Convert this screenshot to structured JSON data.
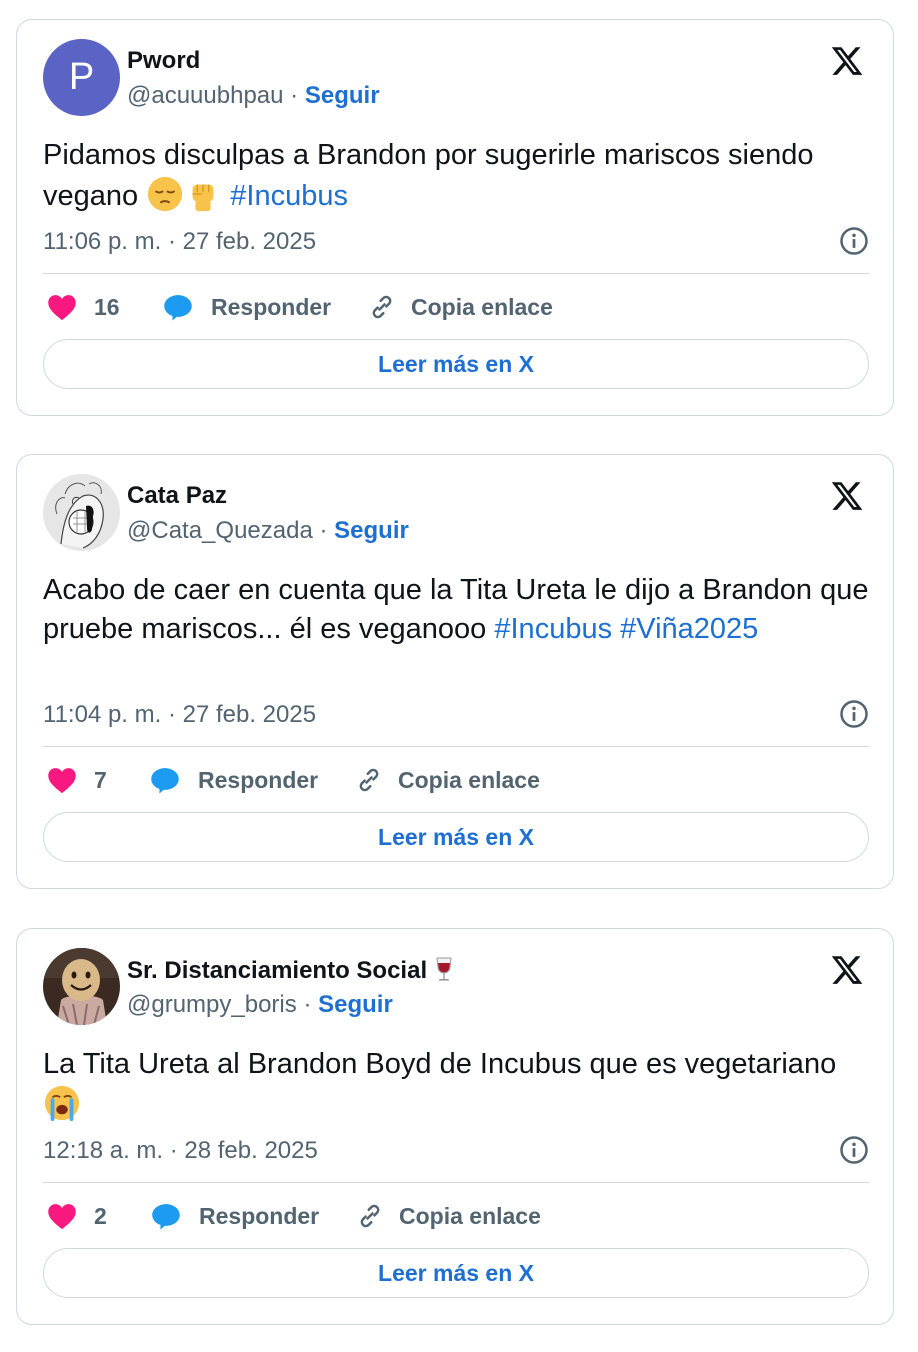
{
  "tweets": [
    {
      "avatar_letter": "P",
      "name": "Pword",
      "handle": "@acuuubhpau",
      "separator": "·",
      "follow_label": "Seguir",
      "text_before": "Pidamos disculpas a Brandon por sugerirle mariscos siendo vegano ",
      "emojis": [
        "pensive-face",
        "raised-fist"
      ],
      "hashtags": [
        "#Incubus"
      ],
      "timestamp": "11:06 p. m. · 27 feb. 2025",
      "likes": "16",
      "reply_label": "Responder",
      "copy_label": "Copia enlace",
      "more_label": "Leer más en X"
    },
    {
      "name": "Cata Paz",
      "handle": "@Cata_Quezada",
      "separator": "·",
      "follow_label": "Seguir",
      "text_before": "Acabo de caer en cuenta que la Tita Ureta le dijo a Brandon que pruebe mariscos... él es veganooo ",
      "hashtags": [
        "#Incubus",
        "#Viña2025"
      ],
      "timestamp": "11:04 p. m. · 27 feb. 2025",
      "likes": "7",
      "reply_label": "Responder",
      "copy_label": "Copia enlace",
      "more_label": "Leer más en X"
    },
    {
      "name": "Sr. Distanciamiento Social",
      "name_emoji": "wine-glass",
      "handle": "@grumpy_boris",
      "separator": "·",
      "follow_label": "Seguir",
      "text_before": "La Tita Ureta al Brandon Boyd de Incubus que es vegetariano ",
      "emojis": [
        "loudly-crying-face"
      ],
      "timestamp": "12:18 a. m. · 28 feb. 2025",
      "likes": "2",
      "reply_label": "Responder",
      "copy_label": "Copia enlace",
      "more_label": "Leer más en X"
    }
  ],
  "colors": {
    "like": "#f91880",
    "reply": "#1d9bf0",
    "link": "#1d6fd1",
    "muted": "#536471",
    "border": "#cfd9de"
  }
}
